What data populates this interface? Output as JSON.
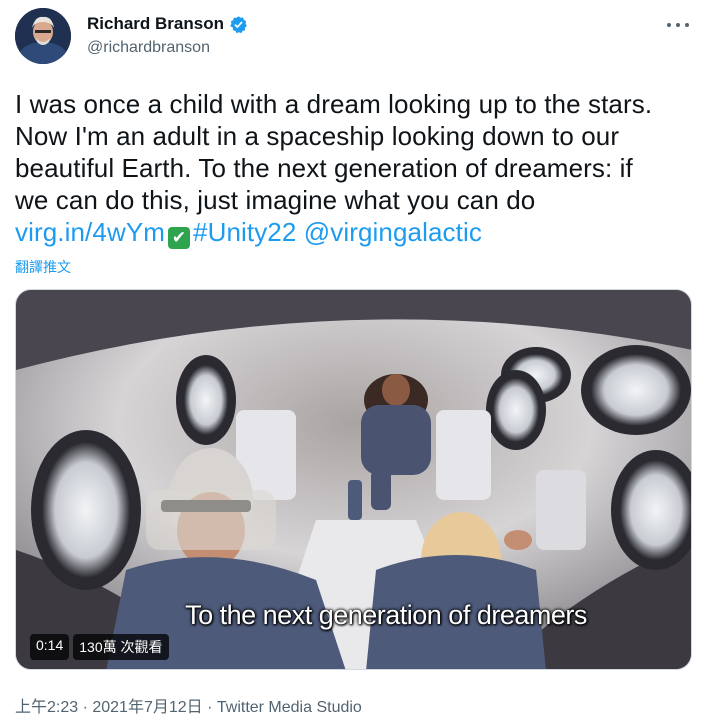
{
  "user": {
    "display_name": "Richard Branson",
    "handle": "@richardbranson",
    "verified_icon": "verified-badge-icon",
    "more_icon": "more-options-icon"
  },
  "tweet": {
    "lines": [
      "I was once a child with a dream looking up to the stars.",
      "Now I'm an adult in a spaceship looking down to our",
      "beautiful Earth. To the next generation of dreamers: if",
      "we can do this, just imagine what you can do"
    ],
    "link_url": "virg.in/4wYm",
    "emoji": "✔",
    "hashtag": "#Unity22",
    "mention": "@virgingalactic",
    "translate_label": "翻譯推文"
  },
  "media": {
    "caption": "To the next generation of dreamers",
    "duration": "0:14",
    "views": "130萬 次觀看"
  },
  "meta": {
    "timestamp": "上午2:23 · 2021年7月12日 · Twitter Media Studio"
  },
  "colors": {
    "link": "#1d9bf0",
    "text": "#0f1419",
    "secondary": "#536471"
  }
}
